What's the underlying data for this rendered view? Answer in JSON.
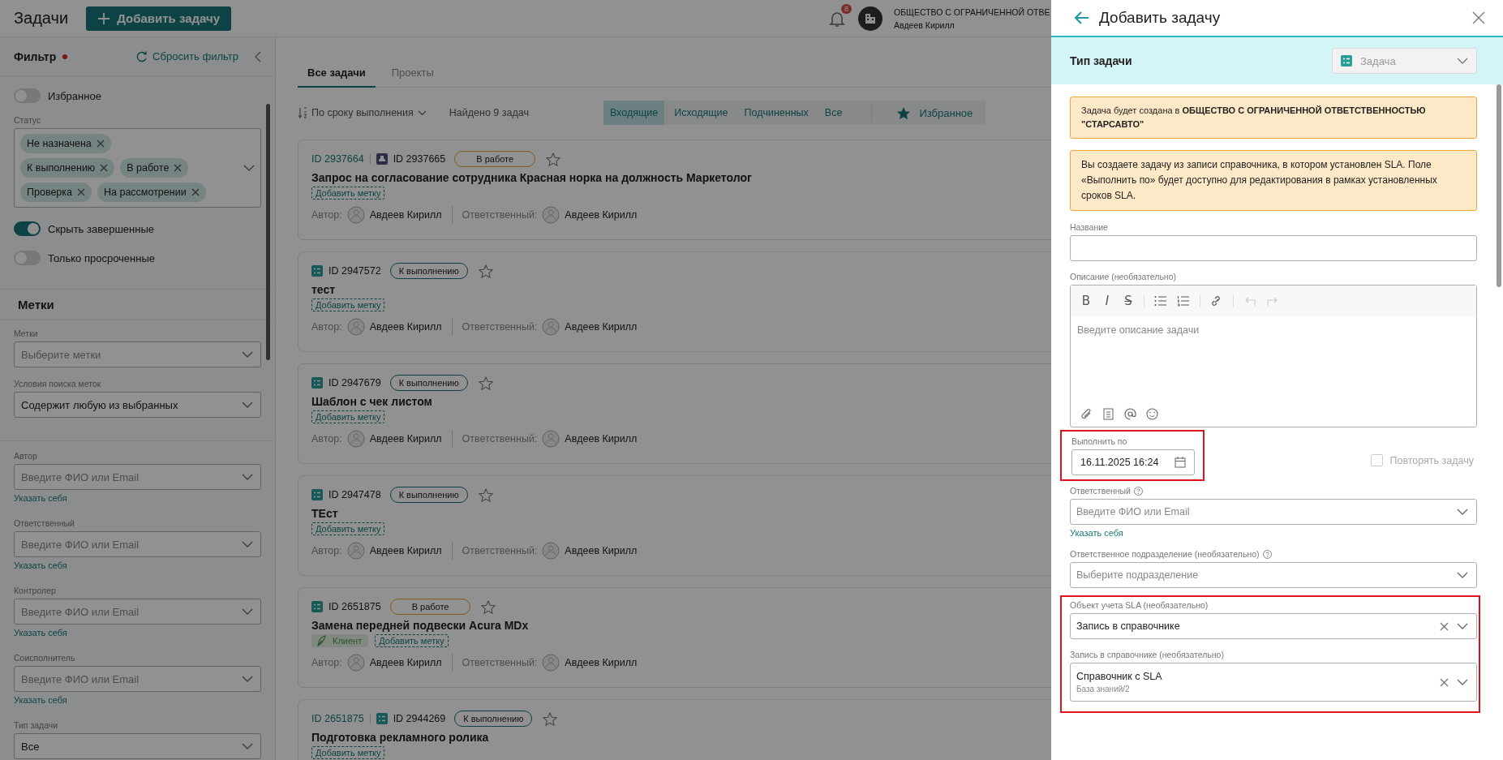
{
  "header": {
    "title": "Задачи",
    "add_button": "Добавить задачу",
    "notifications": "8",
    "org": "ОБЩЕСТВО С ОГРАНИЧЕННОЙ ОТВЕ",
    "user": "Авдеев Кирилл"
  },
  "filter": {
    "title": "Фильтр",
    "modified": true,
    "reset": "Сбросить фильтр",
    "groups": [
      {
        "items": [
          {
            "kind": "toggle",
            "label": "Избранное",
            "on": false
          },
          {
            "kind": "chips",
            "label": "Статус",
            "chip_rows": [
              [
                "Не назначена"
              ],
              [
                "К выполнению",
                "В работе"
              ],
              [
                "Проверка",
                "На рассмотрении"
              ]
            ]
          },
          {
            "kind": "toggle",
            "label": "Скрыть завершенные",
            "on": true
          },
          {
            "kind": "toggle",
            "label": "Только просроченные",
            "on": false
          }
        ]
      },
      {
        "heading": "Метки",
        "items": [
          {
            "kind": "select",
            "label": "Метки",
            "placeholder": "Выберите метки"
          },
          {
            "kind": "select",
            "label": "Условия поиска меток",
            "value": "Содержит любую из выбранных"
          }
        ]
      },
      {
        "items": [
          {
            "kind": "select",
            "label": "Автор",
            "placeholder": "Введите ФИО или Email",
            "self_link": "Указать себя"
          },
          {
            "kind": "select",
            "label": "Ответственный",
            "placeholder": "Введите ФИО или Email",
            "self_link": "Указать себя"
          },
          {
            "kind": "select",
            "label": "Контролер",
            "placeholder": "Введите ФИО или Email",
            "self_link": "Указать себя"
          },
          {
            "kind": "select",
            "label": "Соисполнитель",
            "placeholder": "Введите ФИО или Email",
            "self_link": "Указать себя"
          },
          {
            "kind": "select",
            "label": "Тип задачи",
            "value": "Все"
          }
        ]
      }
    ]
  },
  "tasks": {
    "tabs": [
      {
        "label": "Все задачи",
        "selected": true
      },
      {
        "label": "Проекты",
        "selected": false
      }
    ],
    "sort": "По сроку выполнения",
    "found": "Найдено 9 задач",
    "scopes": [
      {
        "label": "Входящие",
        "selected": true
      },
      {
        "label": "Исходящие",
        "selected": false
      },
      {
        "label": "Подчиненных",
        "selected": false
      },
      {
        "label": "Все",
        "selected": false
      }
    ],
    "favorites": "Избранное",
    "cards": [
      {
        "parent_id": "ID 2937664",
        "kind": "approval",
        "id": "ID 2937665",
        "status": {
          "label": "В работе",
          "kind": "in_progress"
        },
        "starred": false,
        "title": "Запрос на согласование сотрудника Красная норка на должность Маркетолог",
        "add_tag": "Добавить метку",
        "author_label": "Автор:",
        "author": "Авдеев Кирилл",
        "responsible_label": "Ответственный:",
        "responsible": "Авдеев Кирилл"
      },
      {
        "kind": "task",
        "id": "ID 2947572",
        "status": {
          "label": "К выполнению",
          "kind": "todo"
        },
        "starred": false,
        "title": "тест",
        "add_tag": "Добавить метку",
        "author_label": "Автор:",
        "author": "Авдеев Кирилл",
        "responsible_label": "Ответственный:",
        "responsible": "Авдеев Кирилл"
      },
      {
        "kind": "task",
        "id": "ID 2947679",
        "status": {
          "label": "К выполнению",
          "kind": "todo"
        },
        "starred": false,
        "title": "Шаблон с чек листом",
        "add_tag": "Добавить метку",
        "author_label": "Автор:",
        "author": "Авдеев Кирилл",
        "responsible_label": "Ответственный:",
        "responsible": "Авдеев Кирилл"
      },
      {
        "kind": "task",
        "id": "ID 2947478",
        "status": {
          "label": "К выполнению",
          "kind": "todo"
        },
        "starred": false,
        "title": "ТЕст",
        "add_tag": "Добавить метку",
        "author_label": "Автор:",
        "author": "Авдеев Кирилл",
        "responsible_label": "Ответственный:",
        "responsible": "Авдеев Кирилл"
      },
      {
        "kind": "task",
        "id": "ID 2651875",
        "status": {
          "label": "В работе",
          "kind": "in_progress"
        },
        "starred": false,
        "title": "Замена передней подвески Acura MDx",
        "tags": [
          {
            "label": "Клиент"
          }
        ],
        "add_tag": "Добавить метку",
        "author_label": "Автор:",
        "author": "Авдеев Кирилл",
        "responsible_label": "Ответственный:",
        "responsible": "Авдеев Кирилл"
      },
      {
        "parent_id": "ID 2651875",
        "kind": "task",
        "id": "ID 2944269",
        "status": {
          "label": "К выполнению",
          "kind": "todo"
        },
        "starred": false,
        "title": "Подготовка рекламного ролика",
        "add_tag": "Добавить метку"
      }
    ]
  },
  "drawer": {
    "title": "Добавить задачу",
    "type": {
      "label": "Тип задачи",
      "value": "Задача",
      "disabled": true
    },
    "notices": [
      "Задача будет создана в **ОБЩЕСТВО С ОГРАНИЧЕННОЙ ОТВЕТСТВЕННОСТЬЮ \"СТАРСАВТО\"**",
      "Вы создаете задачу из записи справочника, в котором установлен SLA. Поле «Выполнить по» будет доступно для редактирования в рамках установленных сроков SLA."
    ],
    "name_field": {
      "label": "Название"
    },
    "description": {
      "label": "Описание (необязательно)",
      "placeholder": "Введите описание задачи",
      "toolbar": [
        {
          "kind": "bold",
          "glyph": "B"
        },
        {
          "kind": "italic",
          "glyph": "I"
        },
        {
          "kind": "strike",
          "glyph": "S"
        },
        {
          "kind": "sep"
        },
        {
          "kind": "bullets"
        },
        {
          "kind": "numbers"
        },
        {
          "kind": "sep"
        },
        {
          "kind": "link"
        },
        {
          "kind": "sep"
        },
        {
          "kind": "undo",
          "disabled": true
        },
        {
          "kind": "redo",
          "disabled": true
        }
      ]
    },
    "due": {
      "label": "Выполнить по",
      "value": "16.11.2025 16:24",
      "highlighted": true
    },
    "repeat": {
      "label": "Повторять задачу",
      "checked": false,
      "disabled": true
    },
    "fields": [
      {
        "label": "Ответственный",
        "help": true,
        "placeholder": "Введите ФИО или Email",
        "self_link": "Указать себя"
      },
      {
        "label": "Ответственное подразделение (необязательно)",
        "help": true,
        "placeholder": "Выберите подразделение"
      }
    ],
    "sla": {
      "highlighted": true,
      "fields": [
        {
          "label": "Объект учета SLA (необязательно)",
          "value": "Запись в справочнике",
          "clearable": true
        },
        {
          "label": "Запись в справочнике (необязательно)",
          "value": "Справочник с SLA",
          "sub": "База знаний/2",
          "clearable": true
        }
      ]
    }
  }
}
